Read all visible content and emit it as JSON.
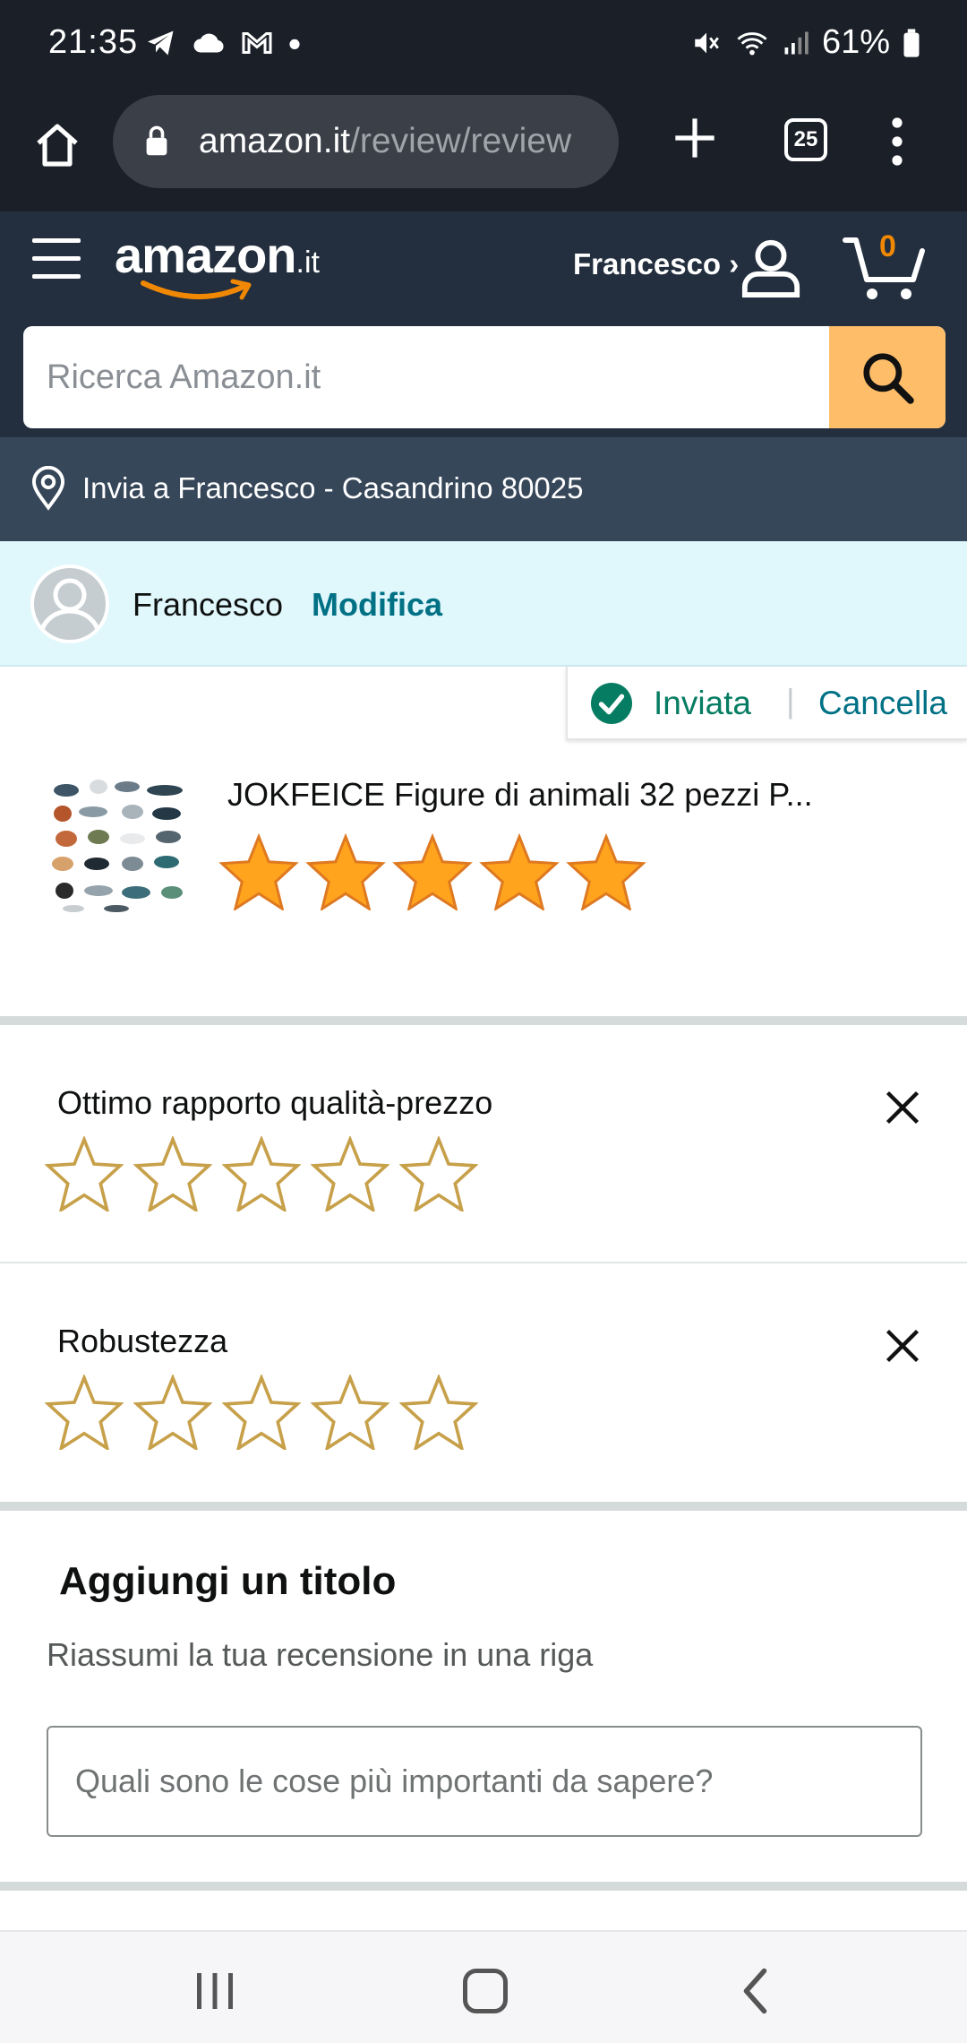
{
  "status_bar": {
    "time": "21:35",
    "battery": "61%",
    "icons": [
      "telegram-icon",
      "cloud-icon",
      "gmail-icon",
      "dot-icon",
      "mute-icon",
      "wifi-icon",
      "signal-icon",
      "battery-icon"
    ]
  },
  "browser": {
    "url_domain": "amazon.it",
    "url_path": "/review/review",
    "tab_count": "25"
  },
  "header": {
    "logo_word": "amazon",
    "logo_tld": ".it",
    "account_label": "Francesco ›",
    "cart_count": "0",
    "search_placeholder": "Ricerca Amazon.it",
    "delivery_text": "Invia a Francesco - Casandrino 80025"
  },
  "profile": {
    "name": "Francesco",
    "edit_label": "Modifica"
  },
  "review_status": {
    "sent_label": "Inviata",
    "separator": "|",
    "cancel_label": "Cancella"
  },
  "product": {
    "title": "JOKFEICE Figure di animali 32 pezzi P...",
    "rating": 5,
    "max_rating": 5
  },
  "attributes": [
    {
      "label": "Ottimo rapporto qualità-prezzo",
      "rating": 0
    },
    {
      "label": "Robustezza",
      "rating": 0
    }
  ],
  "title_section": {
    "heading": "Aggiungi un titolo",
    "hint": "Riassumi la tua recensione in una riga",
    "placeholder": "Quali sono le cose più importanti da sapere?"
  },
  "colors": {
    "header_bg": "#232f3e",
    "status_bg": "#1a1f28",
    "accent_link": "#007185",
    "success": "#067d62",
    "star_fill": "#ffa41c",
    "search_btn": "#febd69"
  }
}
